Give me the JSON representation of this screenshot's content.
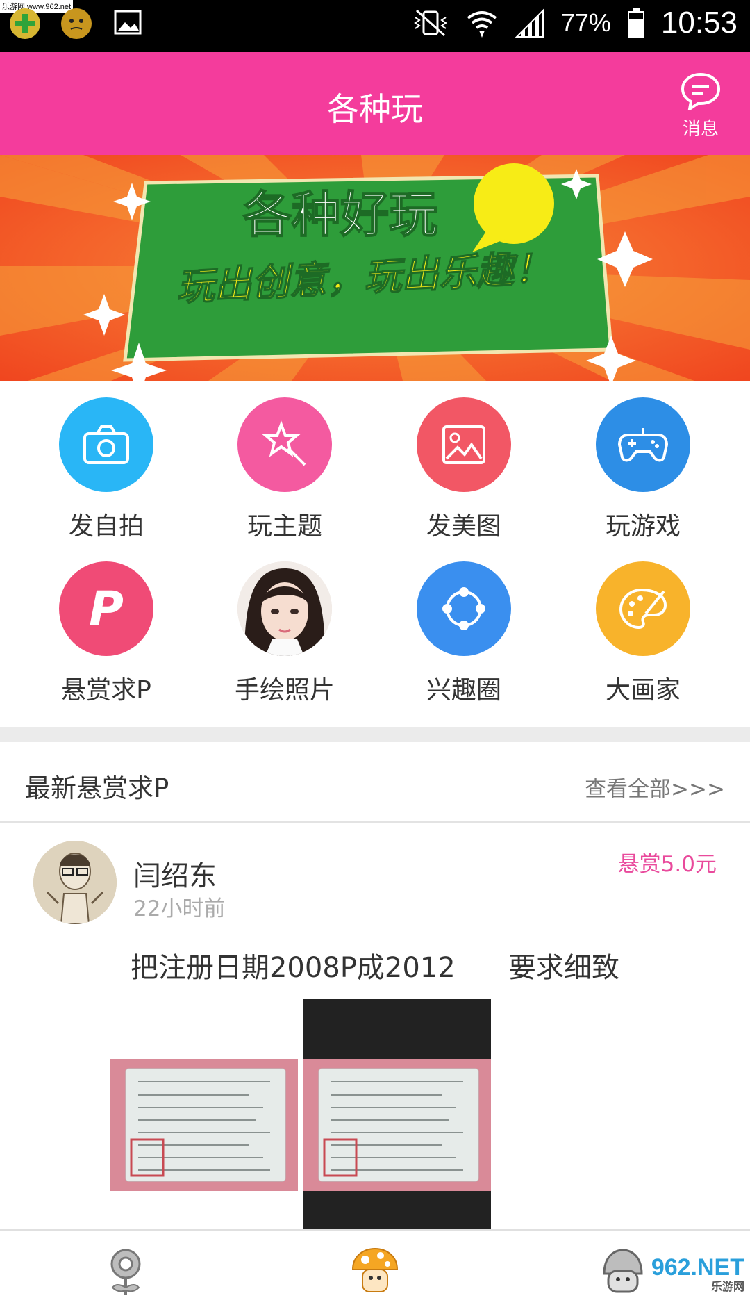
{
  "status_bar": {
    "watermark": "乐游网 www.962.net",
    "battery": "77%",
    "time": "10:53"
  },
  "header": {
    "title": "各种玩",
    "message_label": "消息"
  },
  "banner": {
    "headline": "各种好玩",
    "tagline": "玩出创意，玩出乐趣！"
  },
  "features": [
    {
      "label": "发自拍",
      "icon": "camera-icon",
      "color": "#29b6f6"
    },
    {
      "label": "玩主题",
      "icon": "magic-wand-star-icon",
      "color": "#f45aa0"
    },
    {
      "label": "发美图",
      "icon": "picture-icon",
      "color": "#f25765"
    },
    {
      "label": "玩游戏",
      "icon": "gamepad-icon",
      "color": "#2d8ee6"
    },
    {
      "label": "悬赏求P",
      "icon": "p-letter-icon",
      "color": "#f04b76"
    },
    {
      "label": "手绘照片",
      "icon": "portrait-photo",
      "color": "#cccccc"
    },
    {
      "label": "兴趣圈",
      "icon": "circle-nodes-icon",
      "color": "#3a8fef"
    },
    {
      "label": "大画家",
      "icon": "palette-icon",
      "color": "#f8b32b"
    }
  ],
  "section": {
    "title": "最新悬赏求P",
    "view_all": "查看全部>>>"
  },
  "post": {
    "user": "闫绍东",
    "time": "22小时前",
    "reward": "悬赏5.0元",
    "text": "把注册日期2008P成2012      要求细致"
  },
  "tabbar": {
    "tabs": [
      "flower-icon",
      "mushroom-icon",
      "robot-icon"
    ],
    "watermark_main": "962.NET",
    "watermark_sub": "乐游网"
  },
  "colors": {
    "header": "#f43c9c",
    "reward": "#e94a9c"
  }
}
